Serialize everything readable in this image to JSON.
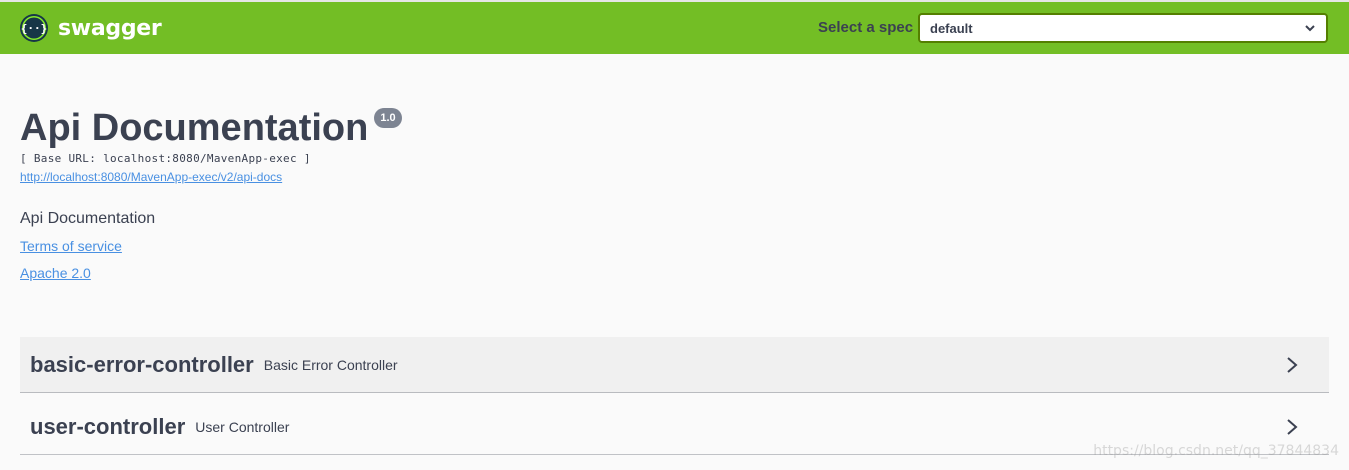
{
  "topbar": {
    "logo_text": "swagger",
    "spec_label": "Select a spec",
    "spec_selected": "default"
  },
  "info": {
    "title": "Api Documentation",
    "version": "1.0",
    "base_url": "[ Base URL: localhost:8080/MavenApp-exec ]",
    "docs_link": "http://localhost:8080/MavenApp-exec/v2/api-docs",
    "description": "Api Documentation",
    "terms_link": "Terms of service",
    "license_link": "Apache 2.0"
  },
  "tags": [
    {
      "name": "basic-error-controller",
      "description": "Basic Error Controller"
    },
    {
      "name": "user-controller",
      "description": "User Controller"
    }
  ],
  "watermark": "https://blog.csdn.net/qq_37844834",
  "colors": {
    "topbar": "#73be25",
    "link": "#4990e2",
    "text": "#3b4151"
  }
}
